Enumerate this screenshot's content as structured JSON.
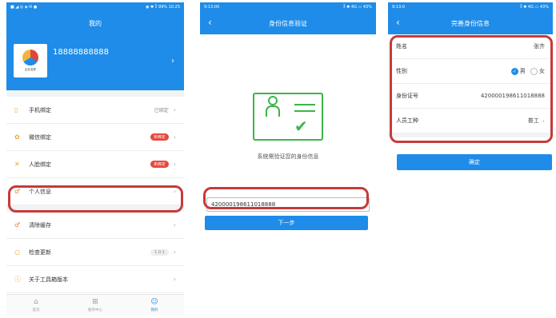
{
  "colors": {
    "brand": "#1e8ce8",
    "highlight": "#c73a3a",
    "success": "#3bb54a",
    "badge": "#e5483d"
  },
  "screen1": {
    "title": "我的",
    "status_left": "■ ◢ ◎ ◈ ✉ ●",
    "status_right": "◉ ✱ ⁑ 99% 10:25",
    "phone_number": "18888888888",
    "avatar_text": "企业名称",
    "menu": [
      {
        "icon": "phone-icon",
        "glyph": "▯",
        "label": "手机绑定",
        "value": "已绑定"
      },
      {
        "icon": "wechat-icon",
        "glyph": "✿",
        "label": "微信绑定",
        "badge": "未绑定"
      },
      {
        "icon": "face-icon",
        "glyph": "✕",
        "label": "人脸绑定",
        "badge": "未绑定"
      },
      {
        "icon": "person-icon",
        "glyph": "♂",
        "label": "个人信息"
      },
      {
        "icon": "cache-icon",
        "glyph": "♂",
        "label": "清除缓存"
      },
      {
        "icon": "update-icon",
        "glyph": "○",
        "label": "检查更新",
        "version": "1.0.1"
      },
      {
        "icon": "info-icon",
        "glyph": "ⓘ",
        "label": "关于工具箱版本"
      }
    ],
    "tabs": [
      {
        "icon": "home-icon",
        "glyph": "⌂",
        "label": "首页"
      },
      {
        "icon": "grid-icon",
        "glyph": "⊞",
        "label": "服务中心"
      },
      {
        "icon": "user-icon",
        "glyph": "☺",
        "label": "我的"
      }
    ]
  },
  "screen2": {
    "title": "身份信息验证",
    "status_left": "9:13:00",
    "status_right": "⁑ ✱ 4G ▭ 43%",
    "hint": "系统需验证您的身份信息",
    "id_number": "420000198611018888",
    "next_label": "下一步"
  },
  "screen3": {
    "title": "完善身份信息",
    "status_left": "9:13:0",
    "status_right": "⁑ ✱ 4G ▭ 43%",
    "fields": [
      {
        "label": "姓名",
        "value": "张齐"
      },
      {
        "label": "性别",
        "male": "男",
        "female": "女",
        "selected": "male"
      },
      {
        "label": "身份证号",
        "value": "420000198611018888"
      },
      {
        "label": "人员工种",
        "value": "普工"
      }
    ],
    "confirm_label": "确定"
  }
}
